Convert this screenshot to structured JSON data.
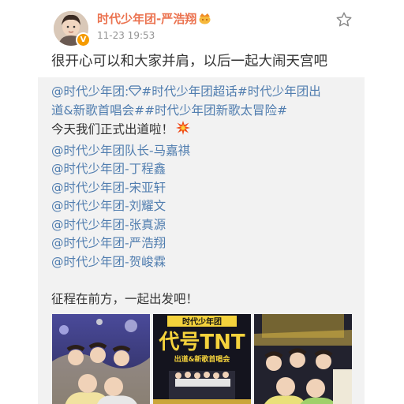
{
  "user": {
    "name": "时代少年团-严浩翔",
    "time": "11-23 19:53"
  },
  "post": {
    "text": "很开心可以和大家并肩，以后一起大闹天宫吧"
  },
  "repost": {
    "line1_mention": "@时代少年团",
    "line1_colon": ":",
    "line1_topic": "#时代少年团超话#时代少年团出",
    "line2_text": "道&新歌首唱会##时代少年团新歌太冒险#",
    "line3_text": "今天我们正式出道啦！",
    "members": [
      "@时代少年团队长-马嘉祺",
      "@时代少年团-丁程鑫",
      "@时代少年团-宋亚轩",
      "@时代少年团-刘耀文",
      "@时代少年团-张真源",
      "@时代少年团-严浩翔",
      "@时代少年团-贺峻霖"
    ],
    "closing": "征程在前方，一起出发吧！"
  },
  "photos": {
    "banner_top": "时代少年团",
    "banner_main": "代号TNT",
    "banner_sub": "出道&新歌首唱会"
  },
  "colors": {
    "username": "#eb7350",
    "link": "#507daf",
    "text": "#333333",
    "repost_bg": "#f2f2f2"
  }
}
